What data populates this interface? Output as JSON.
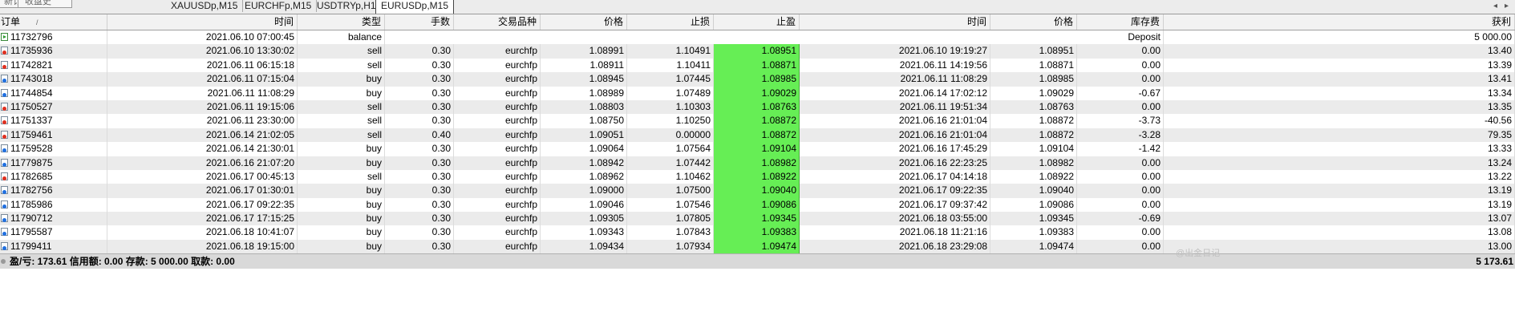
{
  "top_tabs": [
    "新订",
    "收盘史"
  ],
  "chart_tabs": [
    {
      "label": "XAUUSDp,M15",
      "active": false
    },
    {
      "label": "EURCHFp,M15",
      "active": false
    },
    {
      "label": "USDTRYp,H1",
      "active": false
    },
    {
      "label": "EURUSDp,M15",
      "active": true
    }
  ],
  "nav": {
    "left_arrow": "◂",
    "right_arrow": "▸"
  },
  "columns": [
    "订单",
    "时间",
    "类型",
    "手数",
    "交易品种",
    "价格",
    "止损",
    "止盈",
    "时间",
    "价格",
    "库存费",
    "获利"
  ],
  "sort_indicator": "/",
  "colors": {
    "take_profit_bg": "#66ee55",
    "alt_row": "#ebebeb"
  },
  "rows": [
    {
      "order": "11732796",
      "icon": "deposit",
      "open_time": "2021.06.10 07:00:45",
      "type": "balance",
      "lots": "",
      "symbol": "",
      "price": "",
      "sl": "",
      "tp": "",
      "close_time": "",
      "close_price": "",
      "swap": "Deposit",
      "profit": "5 000.00"
    },
    {
      "order": "11735936",
      "icon": "sell",
      "open_time": "2021.06.10 13:30:02",
      "type": "sell",
      "lots": "0.30",
      "symbol": "eurchfp",
      "price": "1.08991",
      "sl": "1.10491",
      "tp": "1.08951",
      "close_time": "2021.06.10 19:19:27",
      "close_price": "1.08951",
      "swap": "0.00",
      "profit": "13.40"
    },
    {
      "order": "11742821",
      "icon": "sell",
      "open_time": "2021.06.11 06:15:18",
      "type": "sell",
      "lots": "0.30",
      "symbol": "eurchfp",
      "price": "1.08911",
      "sl": "1.10411",
      "tp": "1.08871",
      "close_time": "2021.06.11 14:19:56",
      "close_price": "1.08871",
      "swap": "0.00",
      "profit": "13.39"
    },
    {
      "order": "11743018",
      "icon": "buy",
      "open_time": "2021.06.11 07:15:04",
      "type": "buy",
      "lots": "0.30",
      "symbol": "eurchfp",
      "price": "1.08945",
      "sl": "1.07445",
      "tp": "1.08985",
      "close_time": "2021.06.11 11:08:29",
      "close_price": "1.08985",
      "swap": "0.00",
      "profit": "13.41"
    },
    {
      "order": "11744854",
      "icon": "buy",
      "open_time": "2021.06.11 11:08:29",
      "type": "buy",
      "lots": "0.30",
      "symbol": "eurchfp",
      "price": "1.08989",
      "sl": "1.07489",
      "tp": "1.09029",
      "close_time": "2021.06.14 17:02:12",
      "close_price": "1.09029",
      "swap": "-0.67",
      "profit": "13.34"
    },
    {
      "order": "11750527",
      "icon": "sell",
      "open_time": "2021.06.11 19:15:06",
      "type": "sell",
      "lots": "0.30",
      "symbol": "eurchfp",
      "price": "1.08803",
      "sl": "1.10303",
      "tp": "1.08763",
      "close_time": "2021.06.11 19:51:34",
      "close_price": "1.08763",
      "swap": "0.00",
      "profit": "13.35"
    },
    {
      "order": "11751337",
      "icon": "sell",
      "open_time": "2021.06.11 23:30:00",
      "type": "sell",
      "lots": "0.30",
      "symbol": "eurchfp",
      "price": "1.08750",
      "sl": "1.10250",
      "tp": "1.08872",
      "close_time": "2021.06.16 21:01:04",
      "close_price": "1.08872",
      "swap": "-3.73",
      "profit": "-40.56"
    },
    {
      "order": "11759461",
      "icon": "sell",
      "open_time": "2021.06.14 21:02:05",
      "type": "sell",
      "lots": "0.40",
      "symbol": "eurchfp",
      "price": "1.09051",
      "sl": "0.00000",
      "tp": "1.08872",
      "close_time": "2021.06.16 21:01:04",
      "close_price": "1.08872",
      "swap": "-3.28",
      "profit": "79.35"
    },
    {
      "order": "11759528",
      "icon": "buy",
      "open_time": "2021.06.14 21:30:01",
      "type": "buy",
      "lots": "0.30",
      "symbol": "eurchfp",
      "price": "1.09064",
      "sl": "1.07564",
      "tp": "1.09104",
      "close_time": "2021.06.16 17:45:29",
      "close_price": "1.09104",
      "swap": "-1.42",
      "profit": "13.33"
    },
    {
      "order": "11779875",
      "icon": "buy",
      "open_time": "2021.06.16 21:07:20",
      "type": "buy",
      "lots": "0.30",
      "symbol": "eurchfp",
      "price": "1.08942",
      "sl": "1.07442",
      "tp": "1.08982",
      "close_time": "2021.06.16 22:23:25",
      "close_price": "1.08982",
      "swap": "0.00",
      "profit": "13.24"
    },
    {
      "order": "11782685",
      "icon": "sell",
      "open_time": "2021.06.17 00:45:13",
      "type": "sell",
      "lots": "0.30",
      "symbol": "eurchfp",
      "price": "1.08962",
      "sl": "1.10462",
      "tp": "1.08922",
      "close_time": "2021.06.17 04:14:18",
      "close_price": "1.08922",
      "swap": "0.00",
      "profit": "13.22"
    },
    {
      "order": "11782756",
      "icon": "buy",
      "open_time": "2021.06.17 01:30:01",
      "type": "buy",
      "lots": "0.30",
      "symbol": "eurchfp",
      "price": "1.09000",
      "sl": "1.07500",
      "tp": "1.09040",
      "close_time": "2021.06.17 09:22:35",
      "close_price": "1.09040",
      "swap": "0.00",
      "profit": "13.19"
    },
    {
      "order": "11785986",
      "icon": "buy",
      "open_time": "2021.06.17 09:22:35",
      "type": "buy",
      "lots": "0.30",
      "symbol": "eurchfp",
      "price": "1.09046",
      "sl": "1.07546",
      "tp": "1.09086",
      "close_time": "2021.06.17 09:37:42",
      "close_price": "1.09086",
      "swap": "0.00",
      "profit": "13.19"
    },
    {
      "order": "11790712",
      "icon": "buy",
      "open_time": "2021.06.17 17:15:25",
      "type": "buy",
      "lots": "0.30",
      "symbol": "eurchfp",
      "price": "1.09305",
      "sl": "1.07805",
      "tp": "1.09345",
      "close_time": "2021.06.18 03:55:00",
      "close_price": "1.09345",
      "swap": "-0.69",
      "profit": "13.07"
    },
    {
      "order": "11795587",
      "icon": "buy",
      "open_time": "2021.06.18 10:41:07",
      "type": "buy",
      "lots": "0.30",
      "symbol": "eurchfp",
      "price": "1.09343",
      "sl": "1.07843",
      "tp": "1.09383",
      "close_time": "2021.06.18 11:21:16",
      "close_price": "1.09383",
      "swap": "0.00",
      "profit": "13.08"
    },
    {
      "order": "11799411",
      "icon": "buy",
      "open_time": "2021.06.18 19:15:00",
      "type": "buy",
      "lots": "0.30",
      "symbol": "eurchfp",
      "price": "1.09434",
      "sl": "1.07934",
      "tp": "1.09474",
      "close_time": "2021.06.18 23:29:08",
      "close_price": "1.09474",
      "swap": "0.00",
      "profit": "13.00"
    }
  ],
  "footer": {
    "summary": "盈/亏: 173.61  信用额: 0.00  存款: 5 000.00  取款: 0.00",
    "total": "5 173.61"
  },
  "watermark": "@出金日记"
}
